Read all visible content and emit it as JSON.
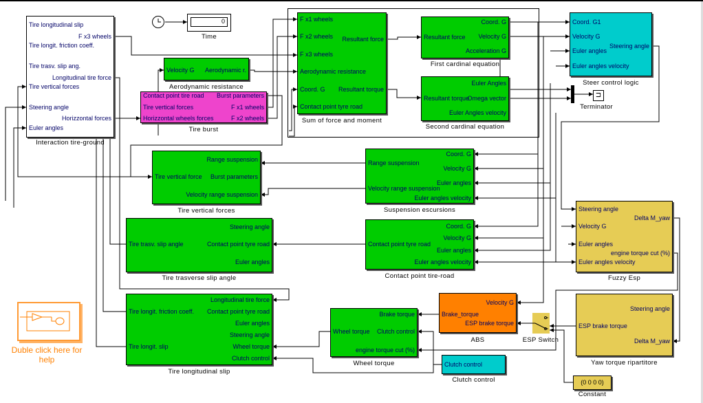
{
  "time": {
    "label": "Time",
    "value": "0"
  },
  "terminator": {
    "label": "Terminator"
  },
  "esp_switch": {
    "label": "ESP Switch"
  },
  "constant": {
    "label": "Constant",
    "value": "(0 0 0 0)"
  },
  "help": {
    "text": "Duble click here for help"
  },
  "colors": {
    "green": "#00cc00",
    "magenta": "#ee44cc",
    "cyan": "#00cccc",
    "yellow": "#e6cc55",
    "orange": "#ff8000",
    "white": "#ffffff"
  },
  "blocks": [
    {
      "title": "Interaction tire-ground",
      "color": "white",
      "ports": [
        "Tire longitudinal slip",
        "Tire longit. friction coeff.",
        "Tire trasv. slip ang.",
        "Tire vertical  forces",
        "Steering angle",
        "Euler angles",
        "F x3 wheels",
        "Longitudinal tire force",
        "Horizzontal forces"
      ]
    },
    {
      "title": "Aerodynamic resistance",
      "color": "green",
      "ports": [
        "Velocity G",
        "Aerodynamic r."
      ]
    },
    {
      "title": "Tire burst",
      "color": "magenta",
      "ports": [
        "Contact point tire road",
        "Tire vertical  forces",
        "Horizzontal wheels forces",
        "Burst parameters",
        "F x1 wheels",
        "F x2 wheels"
      ]
    },
    {
      "title": "Sum of force and moment",
      "color": "green",
      "ports": [
        "F x1 wheels",
        "F x2 wheels",
        "F x3 wheels",
        "Aerodynamic resistance",
        "Coord. G",
        "Contact point tyre road",
        "Resultant force",
        "Resultant torque"
      ]
    },
    {
      "title": "First cardinal equation",
      "color": "green",
      "ports": [
        "Resultant force",
        "Coord. G",
        "Velocity G",
        "Acceleration G"
      ]
    },
    {
      "title": "Second cardinal equation",
      "color": "green",
      "ports": [
        "Resultant torque",
        "Euler Angles",
        "Omega vector",
        "Euler Angles velocity"
      ]
    },
    {
      "title": "Steer control logic",
      "color": "cyan",
      "ports": [
        "Coord. G1",
        "Velocity G",
        "Euler angles",
        "Euler angles velocity",
        "Steering angle"
      ]
    },
    {
      "title": "Tire vertical forces",
      "color": "green",
      "ports": [
        "Range suspension",
        "Tire vertical force",
        "Burst parameters",
        "Velocity range suspension"
      ]
    },
    {
      "title": "Suspension escursions",
      "color": "green",
      "ports": [
        "Range suspension",
        "Velocity range suspension",
        "Coord. G",
        "Velocity G",
        "Euler angles",
        "Euler angles velocity"
      ]
    },
    {
      "title": "Tire trasverse slip angle",
      "color": "green",
      "ports": [
        "Tire trasv. slip angle",
        "Steering angle",
        "Contact point tyre road",
        "Euler angles"
      ]
    },
    {
      "title": "Contact point tire-road",
      "color": "green",
      "ports": [
        "Contact point tyre road",
        "Coord. G",
        "Velocity G",
        "Euler angles",
        "Euler angles velocity"
      ]
    },
    {
      "title": "Fuzzy Esp",
      "color": "yellow",
      "ports": [
        "Steering angle",
        "Velocity G",
        "Euler angles",
        "Euler angles velocity",
        "Delta M_yaw",
        "engine torque cut (%)"
      ]
    },
    {
      "title": "Tire longitudinal slip",
      "color": "green",
      "ports": [
        "Tire longit. friction coeff.",
        "Tire longit. slip",
        "Longitudinal tire force",
        "Contact point tyre road",
        "Euler angles",
        "Steering angle",
        "Wheel torque",
        "Clutch control"
      ]
    },
    {
      "title": "Wheel torque",
      "color": "green",
      "ports": [
        "Wheel torque",
        "Brake torque",
        "Clutch control",
        "engine torque cut (%)"
      ]
    },
    {
      "title": "ABS",
      "color": "orange",
      "ports": [
        "Velocity G",
        "Brake_torque",
        "ESP brake torque"
      ]
    },
    {
      "title": "Yaw torque ripartitore",
      "color": "yellow",
      "ports": [
        "Steering angle",
        "ESP brake torque",
        "Delta M_yaw"
      ]
    },
    {
      "title": "Clutch control",
      "color": "cyan",
      "ports": [
        "Clutch control"
      ]
    }
  ]
}
